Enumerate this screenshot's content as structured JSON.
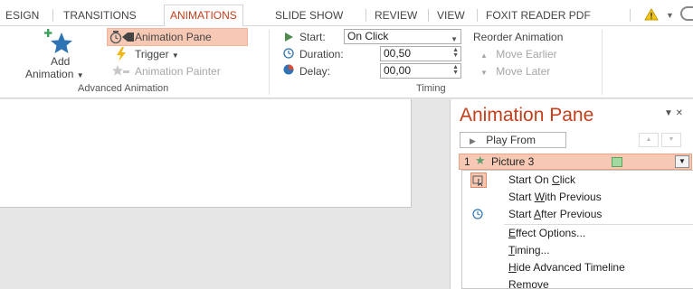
{
  "tabs": [
    "ESIGN",
    "TRANSITIONS",
    "ANIMATIONS",
    "SLIDE SHOW",
    "REVIEW",
    "VIEW",
    "FOXIT READER PDF"
  ],
  "active_tab_index": 2,
  "ribbon": {
    "add_animation": [
      "Add",
      "Animation"
    ],
    "animation_pane": "Animation Pane",
    "trigger": "Trigger",
    "animation_painter": "Animation Painter",
    "advanced_group": "Advanced Animation",
    "start_label": "Start:",
    "start_value": "On Click",
    "duration_label": "Duration:",
    "duration_value": "00,50",
    "delay_label": "Delay:",
    "delay_value": "00,00",
    "timing_group": "Timing",
    "reorder_label": "Reorder Animation",
    "move_earlier": "Move Earlier",
    "move_later": "Move Later"
  },
  "pane": {
    "title": "Animation Pane",
    "play_from": "Play From",
    "item": {
      "number": "1",
      "name": "Picture 3"
    },
    "menu": [
      {
        "pre": "Start On ",
        "u": "C",
        "post": "lick",
        "icon": "start-on-click-icon"
      },
      {
        "pre": "Start ",
        "u": "W",
        "post": "ith Previous",
        "icon": ""
      },
      {
        "pre": "Start ",
        "u": "A",
        "post": "fter Previous",
        "icon": "clock-icon"
      },
      {
        "pre": "",
        "u": "E",
        "post": "ffect Options...",
        "icon": ""
      },
      {
        "pre": "",
        "u": "T",
        "post": "iming...",
        "icon": ""
      },
      {
        "pre": "",
        "u": "H",
        "post": "ide Advanced Timeline",
        "icon": ""
      },
      {
        "pre": "",
        "u": "R",
        "post": "emove",
        "icon": ""
      }
    ]
  },
  "colors": {
    "accent": "#c43e1c",
    "highlight": "#f7c9b5",
    "star_green": "#5f9c6e"
  }
}
